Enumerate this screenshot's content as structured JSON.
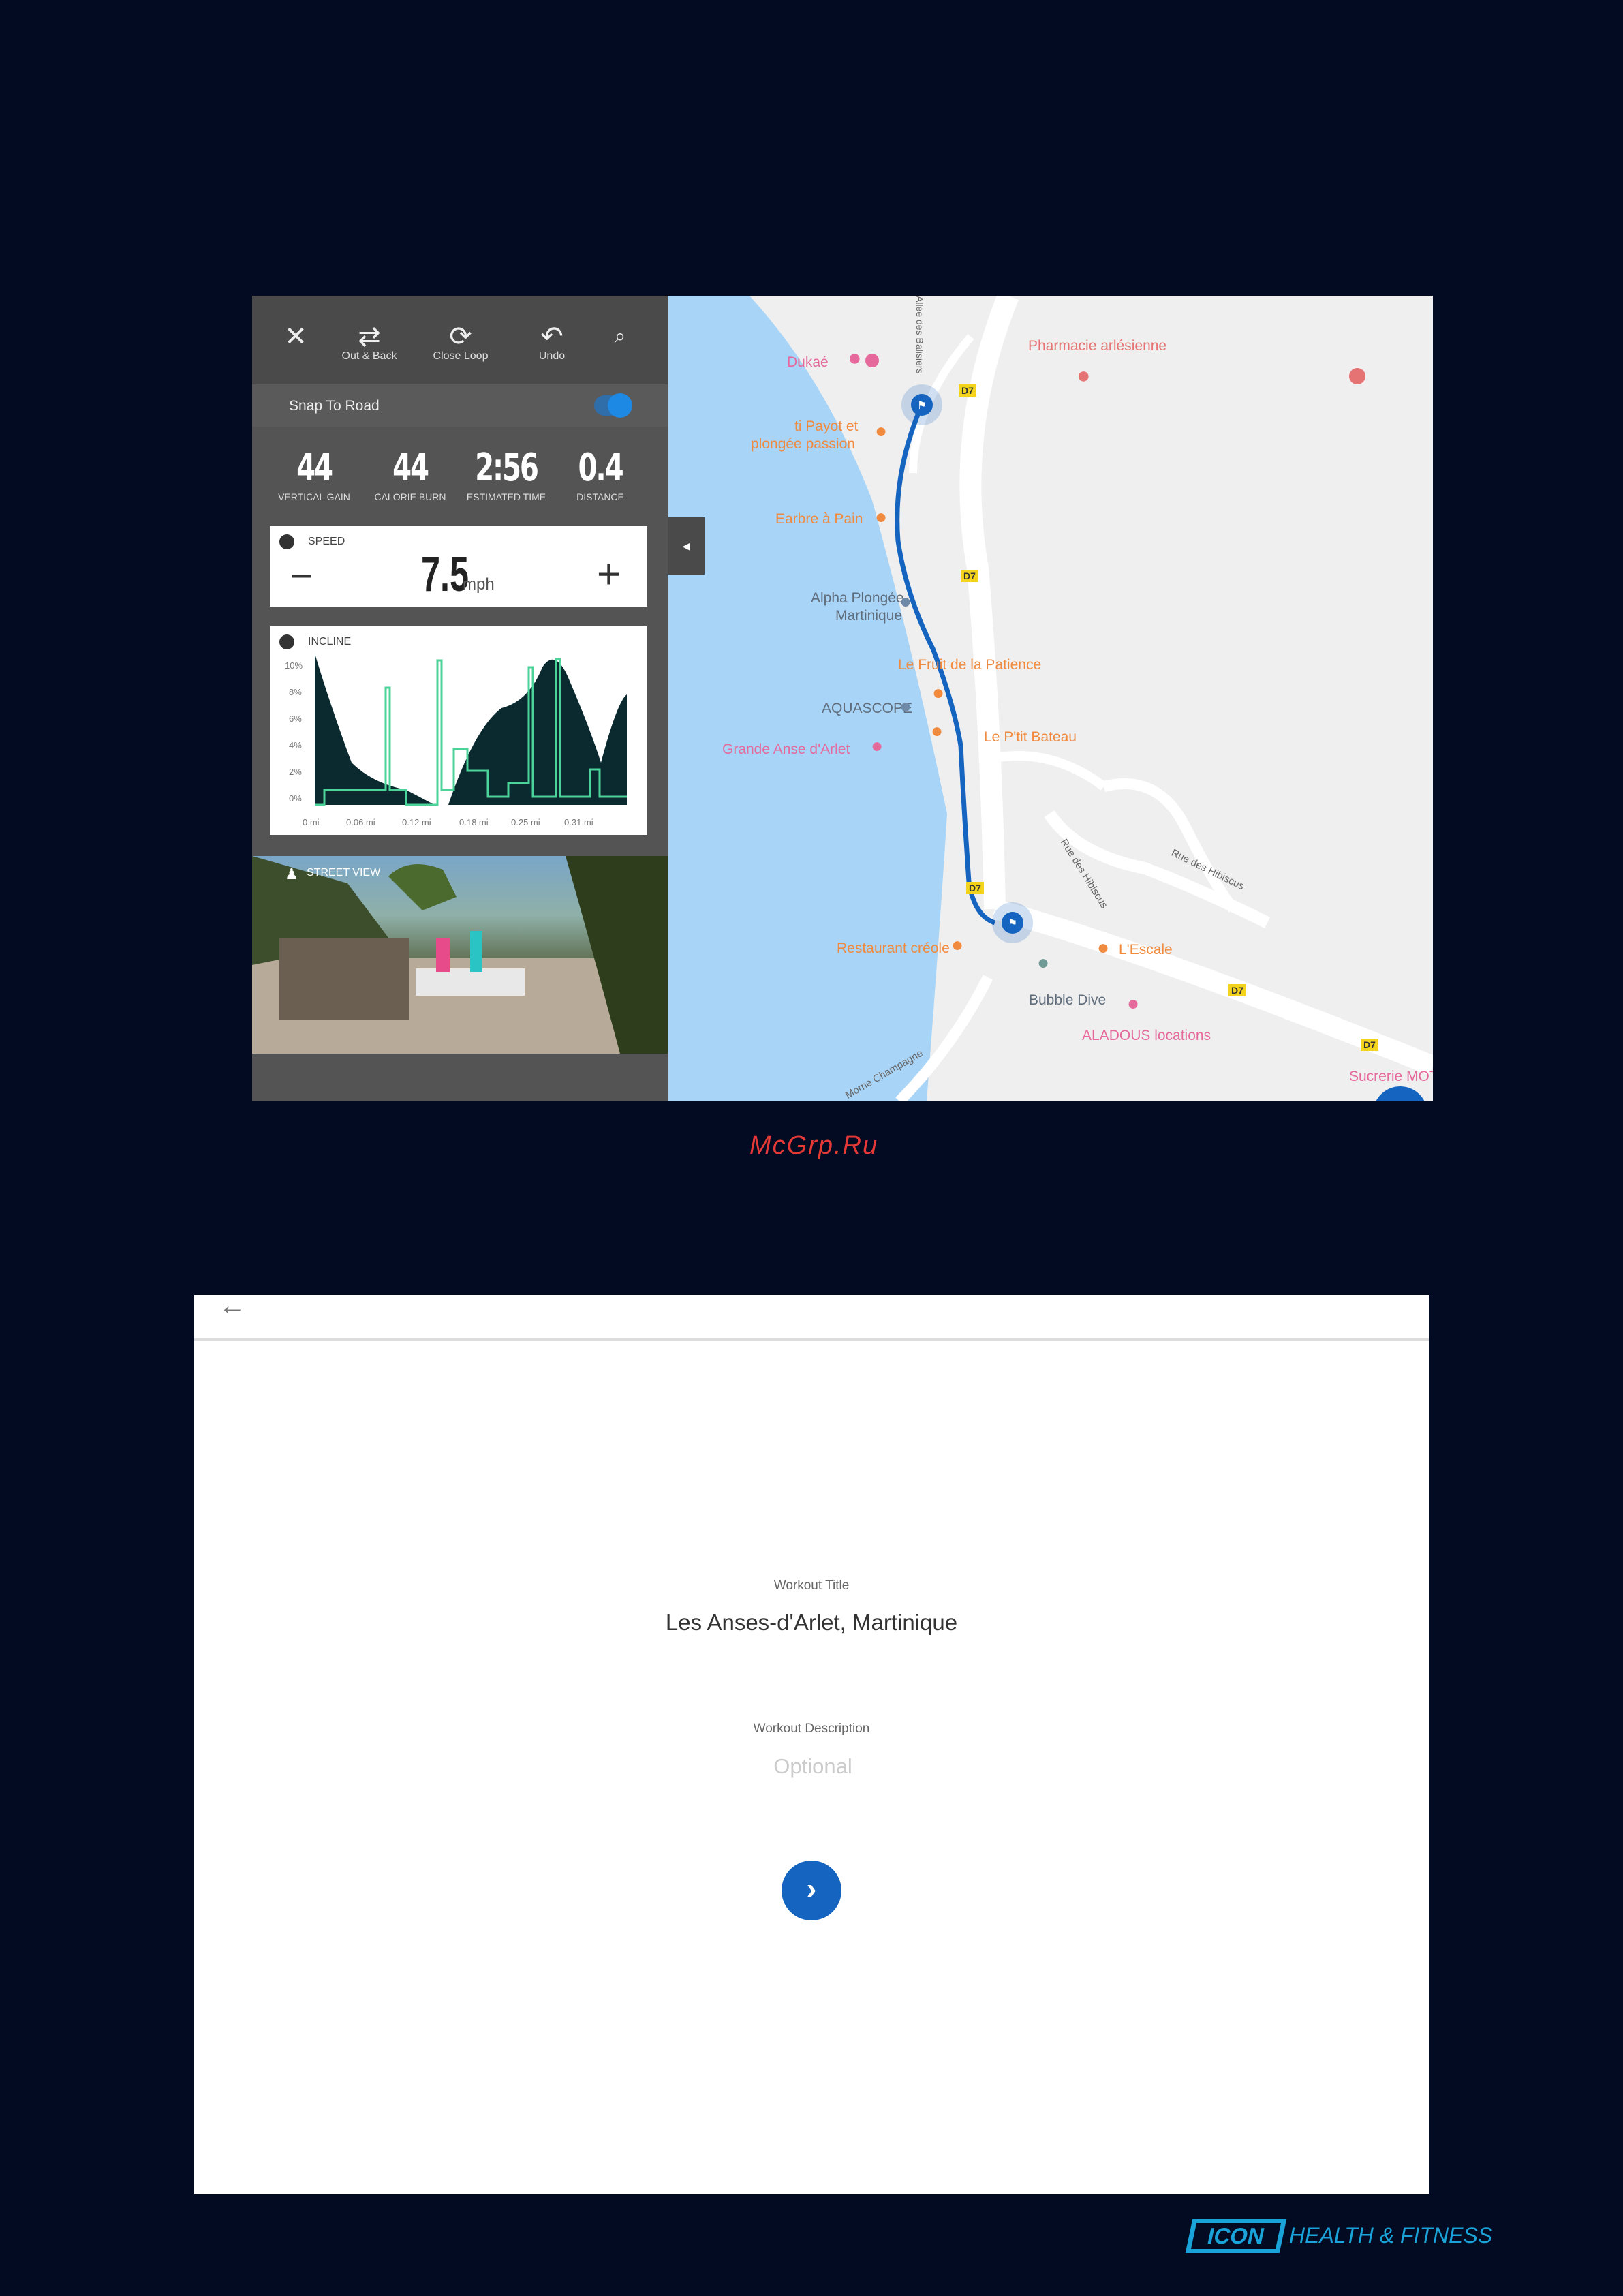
{
  "editor": {
    "toolbar": {
      "close_label": "",
      "out_back": "Out & Back",
      "close_loop": "Close Loop",
      "undo": "Undo"
    },
    "snap_to_road": "Snap To Road",
    "snap_enabled": true,
    "stats": [
      {
        "value": "44",
        "label": "VERTICAL GAIN"
      },
      {
        "value": "44",
        "label": "CALORIE BURN"
      },
      {
        "value": "2:56",
        "label": "ESTIMATED TIME"
      },
      {
        "value": "0.4",
        "label": "DISTANCE"
      }
    ],
    "speed": {
      "label": "SPEED",
      "value": "7.5",
      "unit": "mph"
    },
    "incline": {
      "label": "INCLINE",
      "y_ticks": [
        "10%",
        "8%",
        "6%",
        "4%",
        "2%",
        "0%"
      ],
      "x_ticks": [
        "0 mi",
        "0.06 mi",
        "0.12 mi",
        "0.18 mi",
        "0.25 mi",
        "0.31 mi"
      ]
    },
    "street_view": "STREET VIEW"
  },
  "map": {
    "pois": [
      {
        "name": "Dukaé",
        "color": "#e56a9b"
      },
      {
        "name": "Pharmacie arlésienne",
        "color": "#e57373"
      },
      {
        "name": "ti Payot et",
        "color": "#f08a3e"
      },
      {
        "name": "plongée passion",
        "color": "#f08a3e"
      },
      {
        "name": "Earbre à Pain",
        "color": "#f08a3e"
      },
      {
        "name": "Alpha Plongée",
        "color": "#5f6c7b"
      },
      {
        "name": "Martinique",
        "color": "#5f6c7b"
      },
      {
        "name": "Le Fruit de la Patience",
        "color": "#f08a3e"
      },
      {
        "name": "AQUASCOPE",
        "color": "#5f6c7b"
      },
      {
        "name": "Le P'tit Bateau",
        "color": "#f08a3e"
      },
      {
        "name": "Grande Anse d'Arlet",
        "color": "#e56a9b"
      },
      {
        "name": "Rue des Hibiscus",
        "color": "#666666"
      },
      {
        "name": "Rue des Hibiscus",
        "color": "#666666"
      },
      {
        "name": "Restaurant créole",
        "color": "#f08a3e"
      },
      {
        "name": "L'Escale",
        "color": "#f08a3e"
      },
      {
        "name": "Bubble Dive",
        "color": "#5f6c7b"
      },
      {
        "name": "ALADOUS locations",
        "color": "#e56a9b"
      },
      {
        "name": "Sucrerie MOTE",
        "color": "#e56a9b"
      },
      {
        "name": "Morne Champagne",
        "color": "#666666"
      },
      {
        "name": "Allée des Balisiers",
        "color": "#666666"
      }
    ],
    "road_tag": "D7"
  },
  "watermark": "McGrp.Ru",
  "workout": {
    "title_label": "Workout Title",
    "title_value": "Les Anses-d'Arlet, Martinique",
    "description_label": "Workout Description",
    "description_placeholder": "Optional"
  },
  "footer": {
    "logo": "ICON",
    "tagline": "HEALTH & FITNESS"
  }
}
